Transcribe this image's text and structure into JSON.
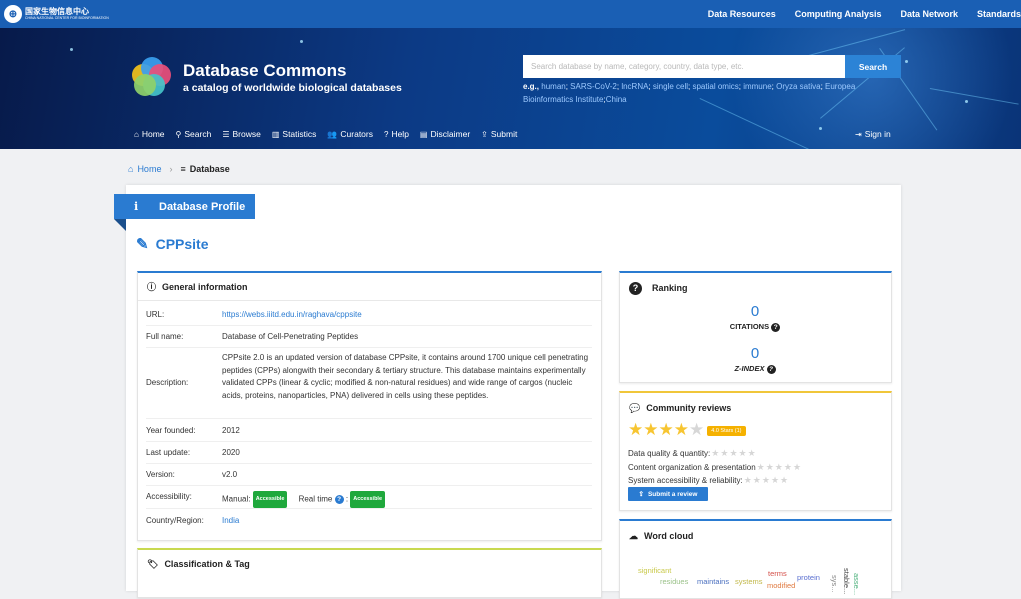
{
  "topbar": {
    "org_zh": "国家生物信息中心",
    "org_en": "CHINA NATIONAL CENTER FOR BIOINFORMATION",
    "nav": [
      "Data Resources",
      "Computing Analysis",
      "Data Network",
      "Standards"
    ]
  },
  "brand": {
    "title": "Database Commons",
    "subtitle": "a catalog of worldwide biological databases"
  },
  "search": {
    "placeholder": "Search database by name, category, country, data type, etc.",
    "button": "Search",
    "eg_label": "e.g.,",
    "examples": [
      "human",
      "SARS-CoV-2",
      "lncRNA",
      "single cell",
      "spatial omics",
      "immune",
      "Oryza sativa",
      "Europea",
      "Bioinformatics Institute",
      "China"
    ]
  },
  "subnav": {
    "items": [
      {
        "label": "Home",
        "icon": "home-icon"
      },
      {
        "label": "Search",
        "icon": "search-icon"
      },
      {
        "label": "Browse",
        "icon": "list-icon"
      },
      {
        "label": "Statistics",
        "icon": "bar-chart-icon"
      },
      {
        "label": "Curators",
        "icon": "users-icon"
      },
      {
        "label": "Help",
        "icon": "help-icon"
      },
      {
        "label": "Disclaimer",
        "icon": "document-icon"
      },
      {
        "label": "Submit",
        "icon": "upload-icon"
      }
    ],
    "signin": "Sign in"
  },
  "breadcrumb": {
    "home": "Home",
    "current": "Database"
  },
  "profile": {
    "ribbon": "Database Profile",
    "db_name": "CPPsite"
  },
  "general": {
    "heading": "General information",
    "url_label": "URL:",
    "url": "https://webs.iiitd.edu.in/raghava/cppsite",
    "fullname_label": "Full name:",
    "fullname": "Database of Cell-Penetrating Peptides",
    "description_label": "Description:",
    "description": "CPPsite 2.0 is an updated version of database CPPsite, it contains around 1700 unique cell penetrating peptides (CPPs) alongwith their secondary & tertiary structure. This database maintains experimentally validated CPPs (linear & cyclic; modified & non-natural residues) and wide range of cargos (nucleic acids, proteins, nanoparticles, PNA) delivered in cells using these peptides.",
    "year_label": "Year founded:",
    "year": "2012",
    "update_label": "Last update:",
    "update": "2020",
    "version_label": "Version:",
    "version": "v2.0",
    "access_label": "Accessibility:",
    "manual_label": "Manual:",
    "manual_status": "Accessible",
    "realtime_label": "Real time",
    "realtime_status": "Accessible",
    "country_label": "Country/Region:",
    "country": "India"
  },
  "classification": {
    "heading": "Classification & Tag"
  },
  "ranking": {
    "heading": "Ranking",
    "citations": "0",
    "citations_label": "CITATIONS",
    "zindex": "0",
    "zindex_label": "Z-INDEX"
  },
  "reviews": {
    "heading": "Community reviews",
    "rating": 4,
    "badge": "4.0 Stars (1)",
    "rows": [
      "Data quality & quantity:",
      "Content organization & presentation",
      "System accessibility & reliability:"
    ],
    "button": "Submit a review"
  },
  "wordcloud": {
    "heading": "Word cloud",
    "words": [
      "significant",
      "residues",
      "maintains",
      "systems",
      "terms",
      "modified",
      "protein",
      "sys...",
      "stable...",
      "asse..."
    ]
  },
  "colors": {
    "primary": "#2a7bd1",
    "topbar": "#1a5fb4",
    "accessible": "#1fa83c",
    "star": "#f7c531"
  }
}
